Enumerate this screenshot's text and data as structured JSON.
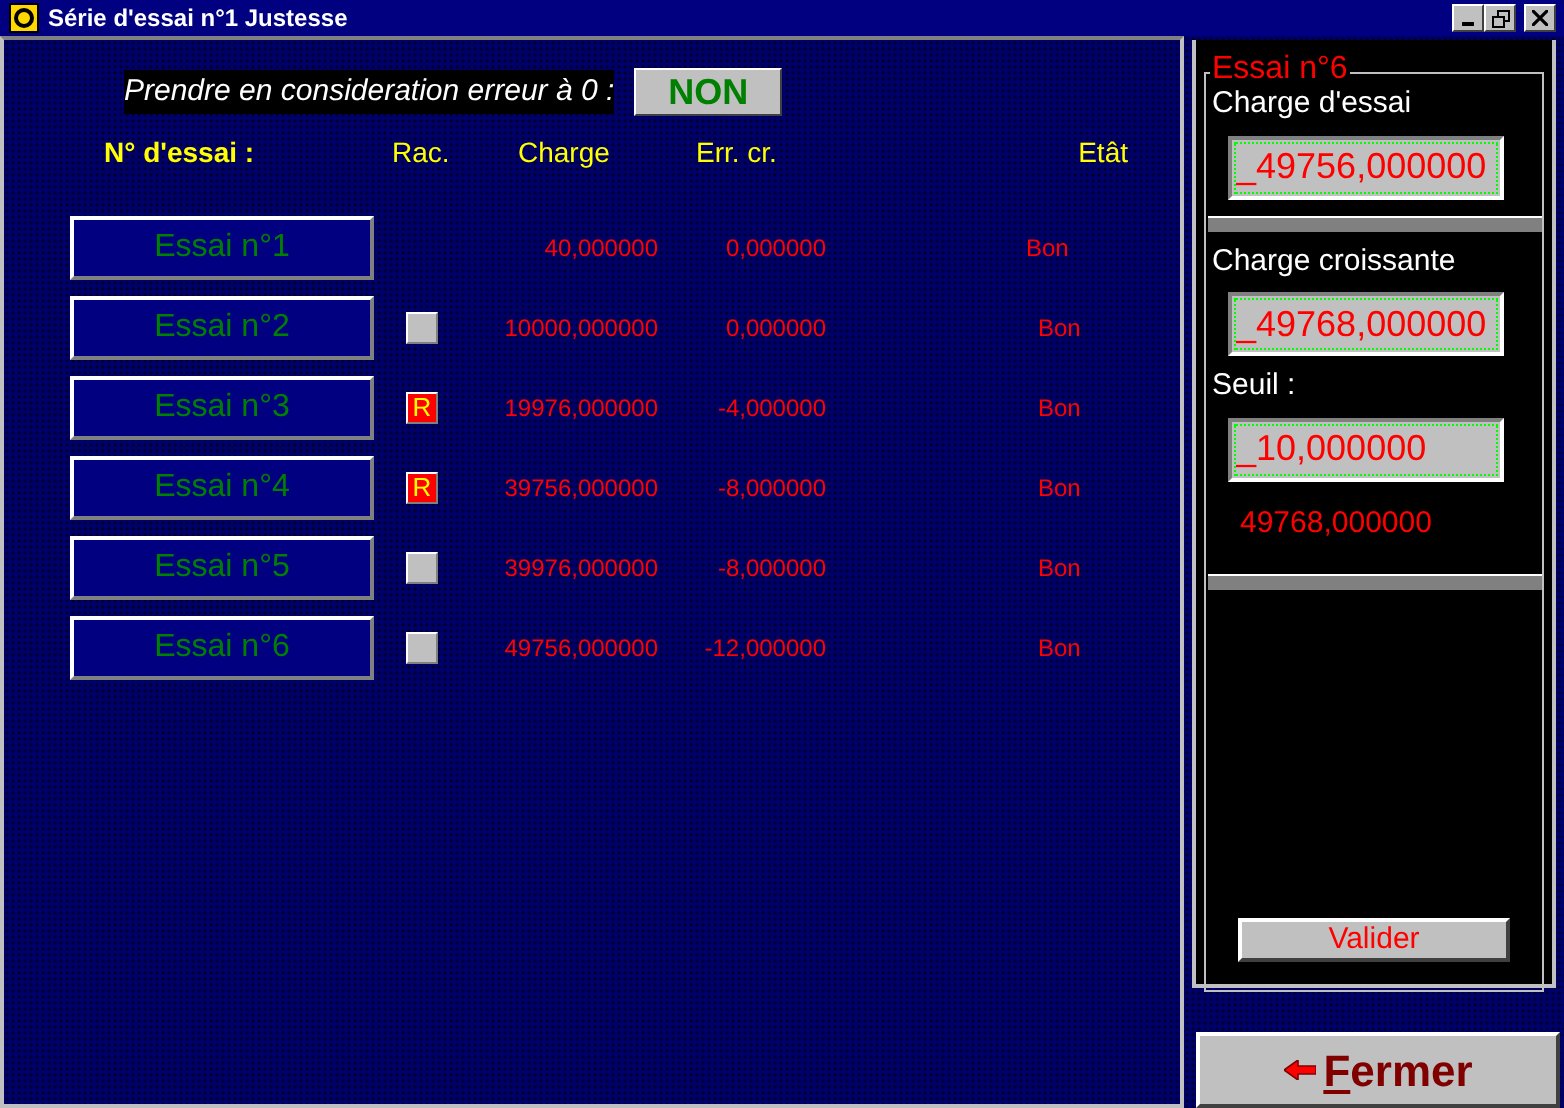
{
  "window": {
    "title": "Série d'essai n°1 Justesse"
  },
  "prompt": {
    "label": "Prendre en consideration erreur à 0 :",
    "button": "NON"
  },
  "columns": [
    "N° d'essai :",
    "Rac.",
    "Charge",
    "Err. cr.",
    "Etât"
  ],
  "rows": [
    {
      "button": "Essai n°1",
      "kind": "no-box",
      "charge": "40,000000",
      "err": "0,000000",
      "etat": "Bon"
    },
    {
      "button": "Essai n°2",
      "kind": "box",
      "rac_marked": false,
      "charge": "10000,000000",
      "err": "0,000000",
      "etat": "Bon"
    },
    {
      "button": "Essai n°3",
      "kind": "box",
      "rac_marked": true,
      "rac_label": "R",
      "charge": "19976,000000",
      "err": "-4,000000",
      "etat": "Bon"
    },
    {
      "button": "Essai n°4",
      "kind": "box",
      "rac_marked": true,
      "rac_label": "R",
      "charge": "39756,000000",
      "err": "-8,000000",
      "etat": "Bon"
    },
    {
      "button": "Essai n°5",
      "kind": "box",
      "rac_marked": false,
      "charge": "39976,000000",
      "err": "-8,000000",
      "etat": "Bon"
    },
    {
      "button": "Essai n°6",
      "kind": "box",
      "rac_marked": false,
      "charge": "49756,000000",
      "err": "-12,000000",
      "etat": "Bon"
    }
  ],
  "panel": {
    "title": "Essai n°6",
    "fields": [
      {
        "label": "Charge d'essai",
        "value": "_49756,000000"
      },
      {
        "label": "Charge croissante",
        "value": "_49768,000000"
      },
      {
        "label": "Seuil :",
        "value": "_10,000000"
      }
    ],
    "result": "49768,000000",
    "button": "Valider"
  },
  "close_button": {
    "label": "Fermer"
  }
}
